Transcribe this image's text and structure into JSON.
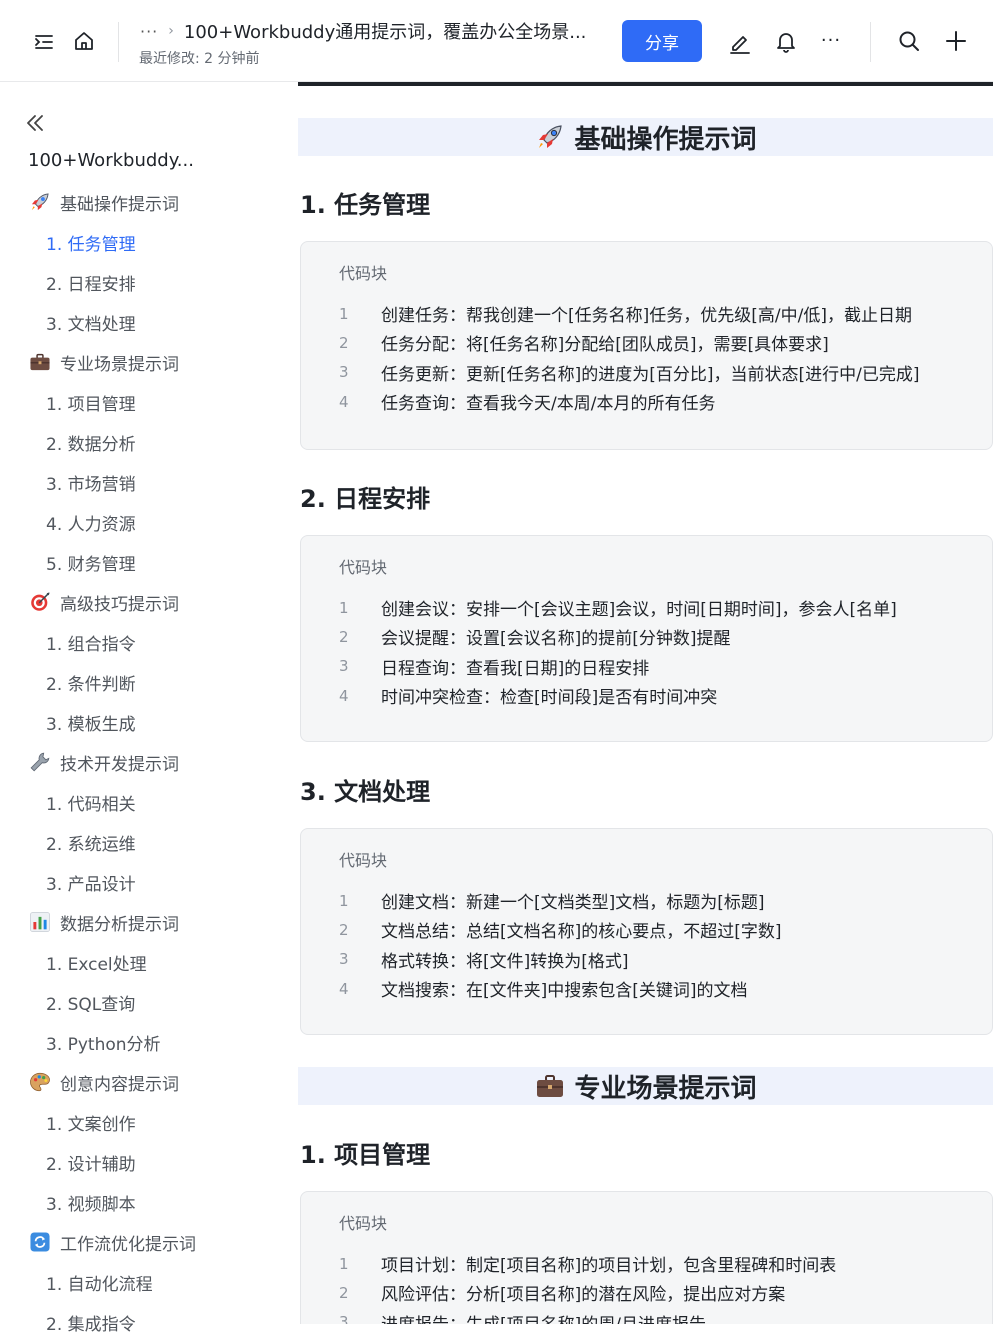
{
  "topbar": {
    "breadcrumb_ellipsis": "···",
    "breadcrumb_sep": "›",
    "doc_title": "100+Workbuddy通用提示词，覆盖办公全场景...",
    "last_modified": "最近修改: 2 分钟前",
    "share_label": "分享",
    "more_label": "···",
    "icons": [
      "sidebar-toggle-icon",
      "home-icon",
      "edit-icon",
      "bell-icon",
      "more-icon",
      "search-icon",
      "plus-icon"
    ]
  },
  "sidebar": {
    "doc_name": "100+Workbuddy...",
    "items": [
      {
        "label": "基础操作提示词",
        "level": 1,
        "icon": "rocket-icon"
      },
      {
        "label": "1. 任务管理",
        "level": 2,
        "active": true
      },
      {
        "label": "2. 日程安排",
        "level": 2
      },
      {
        "label": "3. 文档处理",
        "level": 2
      },
      {
        "label": "专业场景提示词",
        "level": 1,
        "icon": "briefcase-icon"
      },
      {
        "label": "1. 项目管理",
        "level": 2
      },
      {
        "label": "2. 数据分析",
        "level": 2
      },
      {
        "label": "3. 市场营销",
        "level": 2
      },
      {
        "label": "4. 人力资源",
        "level": 2
      },
      {
        "label": "5. 财务管理",
        "level": 2
      },
      {
        "label": "高级技巧提示词",
        "level": 1,
        "icon": "target-icon"
      },
      {
        "label": "1. 组合指令",
        "level": 2
      },
      {
        "label": "2. 条件判断",
        "level": 2
      },
      {
        "label": "3. 模板生成",
        "level": 2
      },
      {
        "label": "技术开发提示词",
        "level": 1,
        "icon": "wrench-icon"
      },
      {
        "label": "1. 代码相关",
        "level": 2
      },
      {
        "label": "2. 系统运维",
        "level": 2
      },
      {
        "label": "3. 产品设计",
        "level": 2
      },
      {
        "label": "数据分析提示词",
        "level": 1,
        "icon": "bar-chart-icon"
      },
      {
        "label": "1. Excel处理",
        "level": 2
      },
      {
        "label": "2. SQL查询",
        "level": 2
      },
      {
        "label": "3. Python分析",
        "level": 2
      },
      {
        "label": "创意内容提示词",
        "level": 1,
        "icon": "palette-icon"
      },
      {
        "label": "1. 文案创作",
        "level": 2
      },
      {
        "label": "2. 设计辅助",
        "level": 2
      },
      {
        "label": "3. 视频脚本",
        "level": 2
      },
      {
        "label": "工作流优化提示词",
        "level": 1,
        "icon": "cycle-icon"
      },
      {
        "label": "1. 自动化流程",
        "level": 2
      },
      {
        "label": "2. 集成指令",
        "level": 2
      }
    ]
  },
  "main": {
    "sections": [
      {
        "title": "基础操作提示词",
        "icon": "rocket-icon"
      },
      {
        "title": "专业场景提示词",
        "icon": "briefcase-icon"
      }
    ],
    "code_label": "代码块",
    "blocks": [
      {
        "heading": "1. 任务管理",
        "lines": [
          "创建任务：帮我创建一个[任务名称]任务，优先级[高/中/低]，截止日期",
          "任务分配：将[任务名称]分配给[团队成员]，需要[具体要求]",
          "任务更新：更新[任务名称]的进度为[百分比]，当前状态[进行中/已完成]",
          "任务查询：查看我今天/本周/本月的所有任务"
        ]
      },
      {
        "heading": "2. 日程安排",
        "lines": [
          "创建会议：安排一个[会议主题]会议，时间[日期时间]，参会人[名单]",
          "会议提醒：设置[会议名称]的提前[分钟数]提醒",
          "日程查询：查看我[日期]的日程安排",
          "时间冲突检查：检查[时间段]是否有时间冲突"
        ]
      },
      {
        "heading": "3. 文档处理",
        "lines": [
          "创建文档：新建一个[文档类型]文档，标题为[标题]",
          "文档总结：总结[文档名称]的核心要点，不超过[字数]",
          "格式转换：将[文件]转换为[格式]",
          "文档搜索：在[文件夹]中搜索包含[关键词]的文档"
        ]
      },
      {
        "heading": "1. 项目管理",
        "lines": [
          "项目计划：制定[项目名称]的项目计划，包含里程碑和时间表",
          "风险评估：分析[项目名称]的潜在风险，提出应对方案",
          "进度报告：生成[项目名称]的周/月进度报告"
        ]
      }
    ]
  },
  "colors": {
    "accent": "#2f6bf6",
    "banner_bg": "#eef2fc",
    "code_bg": "#f5f6f7"
  }
}
